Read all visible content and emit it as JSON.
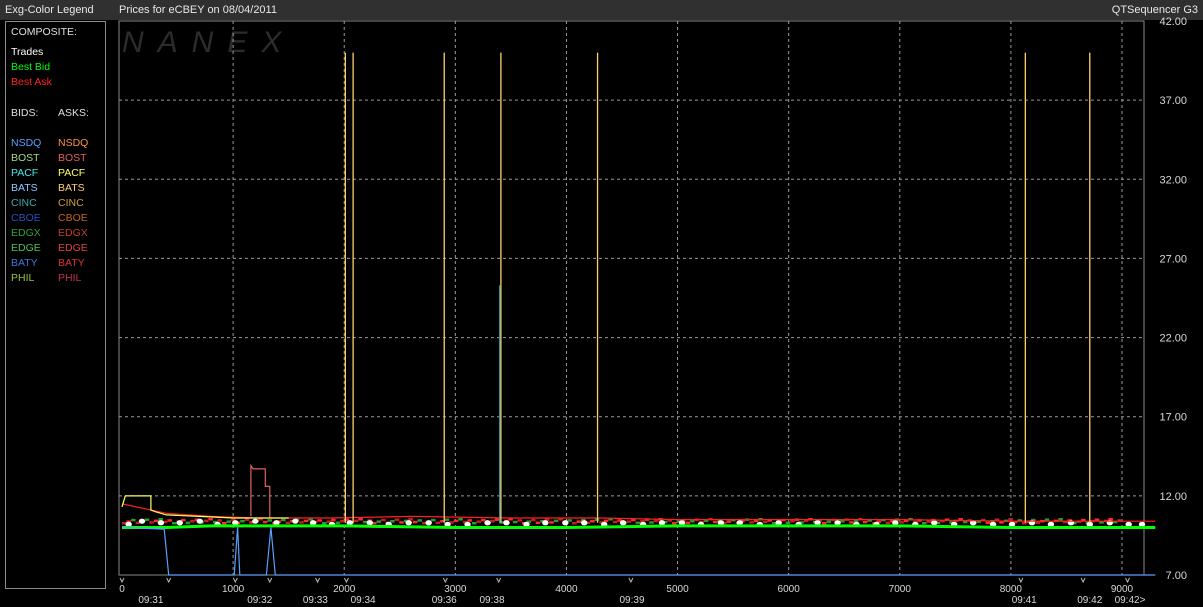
{
  "window": {
    "legend_title": "Exg-Color Legend",
    "chart_title": "Prices for  eCBEY  on  08/04/2011",
    "app_name": "QTSequencer G3"
  },
  "legend": {
    "composite_label": "COMPOSITE:",
    "composite": [
      {
        "label": "Trades",
        "color": "#ffffff"
      },
      {
        "label": "Best Bid",
        "color": "#00ff00"
      },
      {
        "label": "Best Ask",
        "color": "#ff2020"
      }
    ],
    "bids_label": "BIDS:",
    "asks_label": "ASKS:",
    "bids": [
      {
        "label": "NSDQ",
        "color": "#5aa0ff"
      },
      {
        "label": "BOST",
        "color": "#a8d888"
      },
      {
        "label": "PACF",
        "color": "#40e8e8"
      },
      {
        "label": "BATS",
        "color": "#90c8ff"
      },
      {
        "label": "CINC",
        "color": "#40a8a8"
      },
      {
        "label": "CBOE",
        "color": "#2850c0"
      },
      {
        "label": "EDGX",
        "color": "#30a030"
      },
      {
        "label": "EDGE",
        "color": "#50c050"
      },
      {
        "label": "BATY",
        "color": "#3878d8"
      },
      {
        "label": "PHIL",
        "color": "#98c040"
      }
    ],
    "asks": [
      {
        "label": "NSDQ",
        "color": "#ff9040"
      },
      {
        "label": "BOST",
        "color": "#e06060"
      },
      {
        "label": "PACF",
        "color": "#ffff60"
      },
      {
        "label": "BATS",
        "color": "#ffd070"
      },
      {
        "label": "CINC",
        "color": "#d0a040"
      },
      {
        "label": "CBOE",
        "color": "#c86020"
      },
      {
        "label": "EDGX",
        "color": "#c04020"
      },
      {
        "label": "EDGE",
        "color": "#e04040"
      },
      {
        "label": "BATY",
        "color": "#d83030"
      },
      {
        "label": "PHIL",
        "color": "#c03050"
      }
    ]
  },
  "watermark": "NANEX",
  "chart_data": {
    "type": "line",
    "title": "Prices for  eCBEY  on  08/04/2011",
    "xlim": [
      0,
      9300
    ],
    "ylim": [
      7.0,
      42.0
    ],
    "x_ticks": [
      {
        "v": 0,
        "label": "0"
      },
      {
        "v": 1000,
        "label": "1000"
      },
      {
        "v": 2000,
        "label": "2000"
      },
      {
        "v": 3000,
        "label": "3000"
      },
      {
        "v": 4000,
        "label": "4000"
      },
      {
        "v": 5000,
        "label": "5000"
      },
      {
        "v": 6000,
        "label": "6000"
      },
      {
        "v": 7000,
        "label": "7000"
      },
      {
        "v": 8000,
        "label": "8000"
      },
      {
        "v": 9000,
        "label": "9000"
      }
    ],
    "y_ticks": [
      {
        "v": 7.0,
        "label": "7.00"
      },
      {
        "v": 12.0,
        "label": "12.00"
      },
      {
        "v": 17.0,
        "label": "17.00"
      },
      {
        "v": 22.0,
        "label": "22.00"
      },
      {
        "v": 27.0,
        "label": "27.00"
      },
      {
        "v": 32.0,
        "label": "32.00"
      },
      {
        "v": 37.0,
        "label": "37.00"
      },
      {
        "v": 42.0,
        "label": "42.00"
      }
    ],
    "time_labels": [
      {
        "v": 260,
        "label": "09:31"
      },
      {
        "v": 1240,
        "label": "09:32"
      },
      {
        "v": 1740,
        "label": "09:33"
      },
      {
        "v": 2170,
        "label": "09:34"
      },
      {
        "v": 2900,
        "label": "09:36"
      },
      {
        "v": 3330,
        "label": "09:38"
      },
      {
        "v": 4590,
        "label": "09:39"
      },
      {
        "v": 8120,
        "label": "09:41"
      },
      {
        "v": 8710,
        "label": "09:42"
      },
      {
        "v": 9200,
        "label": "09:42>"
      }
    ],
    "time_markers": [
      0,
      420,
      1020,
      1330,
      1760,
      2020,
      2910,
      3390,
      4580,
      8090,
      8650,
      9050
    ],
    "grid": true,
    "series": [
      {
        "name": "Trades",
        "color": "#ffffff",
        "style": "dots",
        "x": [
          60,
          180,
          350,
          520,
          700,
          860,
          1020,
          1200,
          1390,
          1560,
          1720,
          1890,
          2050,
          2230,
          2400,
          2580,
          2760,
          2930,
          3110,
          3290,
          3460,
          3640,
          3810,
          3990,
          4160,
          4340,
          4510,
          4690,
          4860,
          5040,
          5210,
          5390,
          5560,
          5740,
          5910,
          6090,
          6260,
          6440,
          6610,
          6790,
          6960,
          7140,
          7310,
          7490,
          7660,
          7840,
          8010,
          8190,
          8360,
          8540,
          8710,
          8890,
          9060,
          9180
        ],
        "y": [
          10.2,
          10.4,
          10.3,
          10.3,
          10.4,
          10.2,
          10.3,
          10.4,
          10.3,
          10.4,
          10.3,
          10.2,
          10.3,
          10.3,
          10.2,
          10.3,
          10.3,
          10.2,
          10.2,
          10.3,
          10.3,
          10.2,
          10.3,
          10.3,
          10.3,
          10.2,
          10.3,
          10.2,
          10.3,
          10.3,
          10.2,
          10.3,
          10.3,
          10.2,
          10.3,
          10.2,
          10.3,
          10.3,
          10.2,
          10.2,
          10.3,
          10.2,
          10.3,
          10.2,
          10.3,
          10.2,
          10.2,
          10.3,
          10.2,
          10.3,
          10.2,
          10.3,
          10.2,
          10.2
        ]
      },
      {
        "name": "Best Bid",
        "color": "#00ff00",
        "style": "line",
        "x": [
          0,
          400,
          800,
          1300,
          2000,
          3000,
          4000,
          5000,
          6000,
          7000,
          8000,
          9000,
          9300
        ],
        "y": [
          10.0,
          10.0,
          10.1,
          10.1,
          10.1,
          10.0,
          10.0,
          10.1,
          10.1,
          10.1,
          10.0,
          10.0,
          10.0
        ]
      },
      {
        "name": "Best Ask",
        "color": "#ff2020",
        "style": "line",
        "x": [
          0,
          400,
          800,
          1200,
          1900,
          2600,
          3500,
          4300,
          5000,
          6000,
          7000,
          8000,
          8800,
          9300
        ],
        "y": [
          11.5,
          10.9,
          10.7,
          10.6,
          10.6,
          10.7,
          10.6,
          10.6,
          10.5,
          10.5,
          10.5,
          10.4,
          10.4,
          10.4
        ]
      },
      {
        "name": "NSDQ",
        "color": "#5aa0ff",
        "style": "line",
        "x": [
          0,
          380,
          420,
          500,
          1010,
          1040,
          1060,
          1300,
          1340,
          1380,
          2000,
          9300
        ],
        "y": [
          10.0,
          9.9,
          7.0,
          7.0,
          7.0,
          10.0,
          7.0,
          7.0,
          10.0,
          7.0,
          7.0,
          7.0
        ]
      },
      {
        "name": "BATS",
        "color": "#ffd070",
        "style": "spikes",
        "x": [
          2010,
          2080,
          2900,
          3410,
          4280,
          8130,
          8710
        ],
        "y": [
          40.0,
          40.0,
          40.0,
          40.0,
          40.0,
          40.0,
          40.0
        ]
      },
      {
        "name": "BOST",
        "color": "#e06060",
        "style": "line",
        "x": [
          1160,
          1160,
          1180,
          1290,
          1290,
          1330,
          1330
        ],
        "y": [
          10.7,
          13.9,
          13.7,
          13.7,
          12.6,
          12.6,
          10.6
        ]
      },
      {
        "name": "PACF",
        "color": "#ffff60",
        "style": "line",
        "x": [
          0,
          30,
          260,
          260,
          300,
          400,
          700,
          1000,
          1500
        ],
        "y": [
          11.3,
          12.0,
          12.0,
          11.1,
          11.0,
          10.8,
          10.7,
          10.6,
          10.6
        ]
      },
      {
        "name": "CINC",
        "color": "#40a8a8",
        "style": "spikes",
        "x": [
          3400
        ],
        "y": [
          25.3
        ]
      }
    ]
  }
}
